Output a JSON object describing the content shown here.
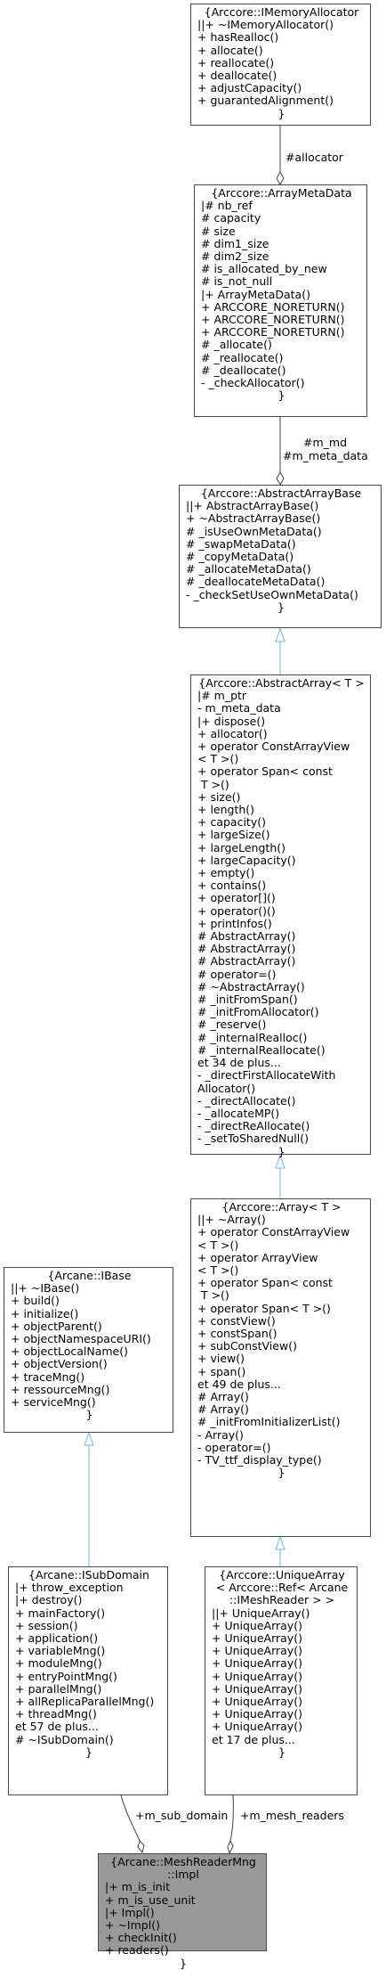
{
  "boxes": {
    "imemory_allocator": {
      "title": [
        "{Arccore::IMemoryAllocator"
      ],
      "lines": [
        "||+ ~IMemoryAllocator()",
        "+ hasRealloc()",
        "+ allocate()",
        "+ reallocate()",
        "+ deallocate()",
        "+ adjustCapacity()",
        "+ guarantedAlignment()"
      ]
    },
    "array_meta_data": {
      "title": [
        "{Arccore::ArrayMetaData"
      ],
      "lines": [
        "|# nb_ref",
        "# capacity",
        "# size",
        "# dim1_size",
        "# dim2_size",
        "# is_allocated_by_new",
        "# is_not_null",
        "|+ ArrayMetaData()",
        "+ ARCCORE_NORETURN()",
        "+ ARCCORE_NORETURN()",
        "+ ARCCORE_NORETURN()",
        "# _allocate()",
        "# _reallocate()",
        "# _deallocate()",
        "- _checkAllocator()"
      ]
    },
    "abstract_array_base": {
      "title": [
        "{Arccore::AbstractArrayBase"
      ],
      "lines": [
        "||+ AbstractArrayBase()",
        "+ ~AbstractArrayBase()",
        "# _isUseOwnMetaData()",
        "# _swapMetaData()",
        "# _copyMetaData()",
        "# _allocateMetaData()",
        "# _deallocateMetaData()",
        "- _checkSetUseOwnMetaData()"
      ]
    },
    "abstract_array": {
      "title": [
        "{Arccore::AbstractArray< T >"
      ],
      "lines": [
        "|# m_ptr",
        "- m_meta_data",
        "|+ dispose()",
        "+ allocator()",
        "+ operator ConstArrayView",
        "< T >()",
        "+ operator Span< const",
        " T >()",
        "+ size()",
        "+ length()",
        "+ capacity()",
        "+ largeSize()",
        "+ largeLength()",
        "+ largeCapacity()",
        "+ empty()",
        "+ contains()",
        "+ operator[]()",
        "+ operator()()",
        "+ printInfos()",
        "# AbstractArray()",
        "# AbstractArray()",
        "# AbstractArray()",
        "# operator=()",
        "# ~AbstractArray()",
        "# _initFromSpan()",
        "# _initFromAllocator()",
        "# _reserve()",
        "# _internalRealloc()",
        "# _internalReallocate()",
        "et 34 de plus...",
        "- _directFirstAllocateWith",
        "Allocator()",
        "- _directAllocate()",
        "- _allocateMP()",
        "- _directReAllocate()",
        "- _setToSharedNull()"
      ]
    },
    "array": {
      "title": [
        "{Arccore::Array< T >"
      ],
      "lines": [
        "||+ ~Array()",
        "+ operator ConstArrayView",
        "< T >()",
        "+ operator ArrayView",
        "< T >()",
        "+ operator Span< const",
        " T >()",
        "+ operator Span< T >()",
        "+ constView()",
        "+ constSpan()",
        "+ subConstView()",
        "+ view()",
        "+ span()",
        "et 49 de plus...",
        "# Array()",
        "# Array()",
        "# _initFromInitializerList()",
        "- Array()",
        "- operator=()",
        "- TV_ttf_display_type()"
      ]
    },
    "ibase": {
      "title": [
        "{Arcane::IBase"
      ],
      "lines": [
        "||+ ~IBase()",
        "+ build()",
        "+ initialize()",
        "+ objectParent()",
        "+ objectNamespaceURI()",
        "+ objectLocalName()",
        "+ objectVersion()",
        "+ traceMng()",
        "+ ressourceMng()",
        "+ serviceMng()"
      ]
    },
    "isubdomain": {
      "title": [
        "{Arcane::ISubDomain"
      ],
      "lines": [
        "|+ throw_exception",
        "|+ destroy()",
        "+ mainFactory()",
        "+ session()",
        "+ application()",
        "+ variableMng()",
        "+ moduleMng()",
        "+ entryPointMng()",
        "+ parallelMng()",
        "+ allReplicaParallelMng()",
        "+ threadMng()",
        "et 57 de plus...",
        "# ~ISubDomain()"
      ]
    },
    "unique_array": {
      "title": [
        "{Arccore::UniqueArray",
        "< Arccore::Ref< Arcane",
        "::IMeshReader > >"
      ],
      "lines": [
        "||+ UniqueArray()",
        "+ UniqueArray()",
        "+ UniqueArray()",
        "+ UniqueArray()",
        "+ UniqueArray()",
        "+ UniqueArray()",
        "+ UniqueArray()",
        "+ UniqueArray()",
        "+ UniqueArray()",
        "+ UniqueArray()",
        "et 17 de plus..."
      ]
    },
    "mesh_reader_impl": {
      "title": [
        "{Arcane::MeshReaderMng",
        "::Impl"
      ],
      "lines": [
        "|+ m_is_init",
        "+ m_is_use_unit",
        "|+ Impl()",
        "+ ~Impl()",
        "+ checkInit()",
        "+ readers()"
      ]
    }
  },
  "closing_brace": "}",
  "edge_labels": {
    "allocator": "#allocator",
    "m_md": "#m_md",
    "m_meta_data": "#m_meta_data",
    "m_sub_domain": "+m_sub_domain",
    "m_mesh_readers": "+m_mesh_readers"
  },
  "colors": {
    "inheritance_edge": "#63b8ff",
    "composition_edge": "#404040",
    "box_border": "#4a4a4a",
    "focus_fill": "#999999"
  }
}
